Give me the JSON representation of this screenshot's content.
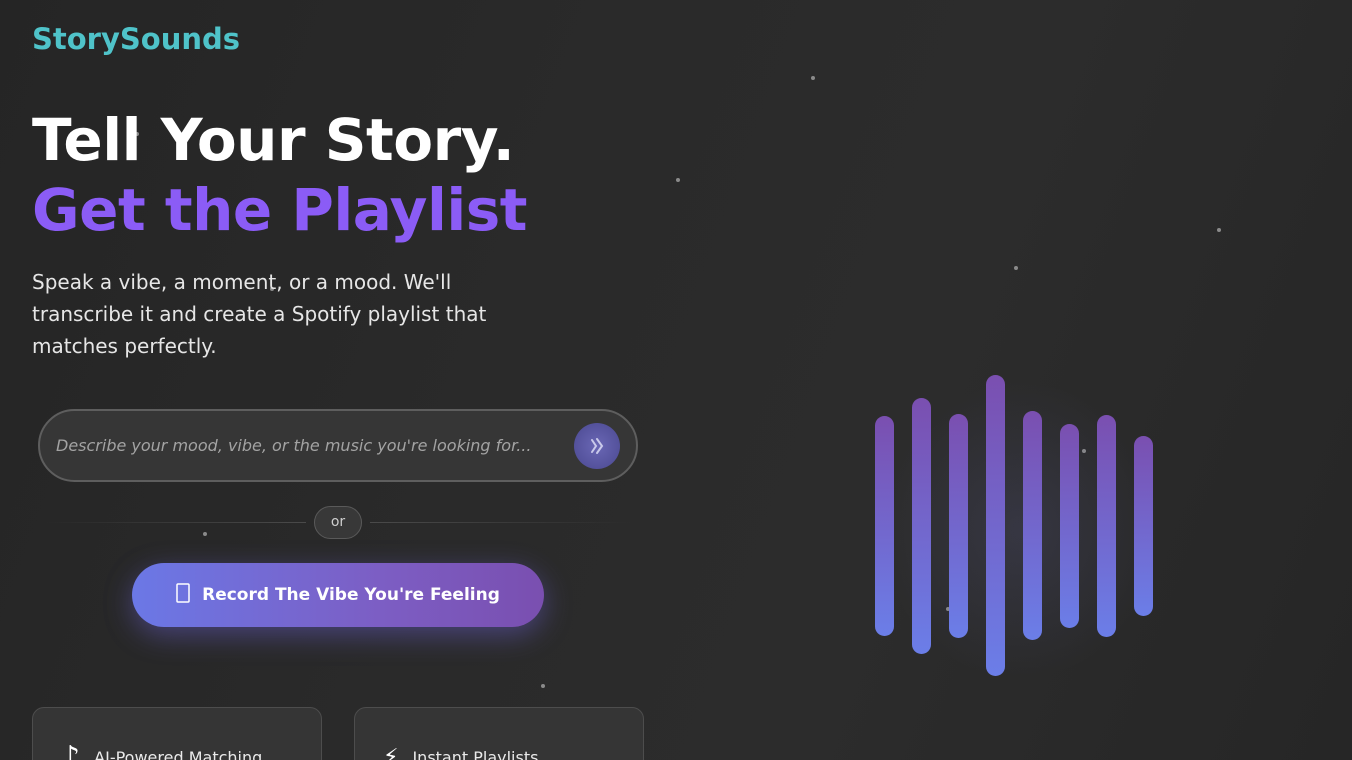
{
  "brand": {
    "name": "StorySounds",
    "color": "#4fc3c9"
  },
  "hero": {
    "headline_line1": "Tell Your Story.",
    "headline_line2": "Get the Playlist",
    "subtitle": "Speak a vibe, a moment, or a mood. We'll transcribe it and create a Spotify playlist that matches perfectly."
  },
  "search": {
    "placeholder": "Describe your mood, vibe, or the music you're looking for...",
    "value": "",
    "voice_icon": "voice-wave-icon"
  },
  "divider": {
    "label": "or"
  },
  "record_button": {
    "label": "Record The Vibe You're Feeling",
    "icon": "microphone-icon"
  },
  "features": [
    {
      "label": "AI-Powered Matching",
      "icon": "music-note-icon"
    },
    {
      "label": "Instant Playlists",
      "icon": "lightning-icon"
    }
  ],
  "colors": {
    "accent_purple": "#8b5cf6",
    "gradient_start": "#6b78e6",
    "gradient_end": "#7a4fb0",
    "background": "#262626"
  }
}
